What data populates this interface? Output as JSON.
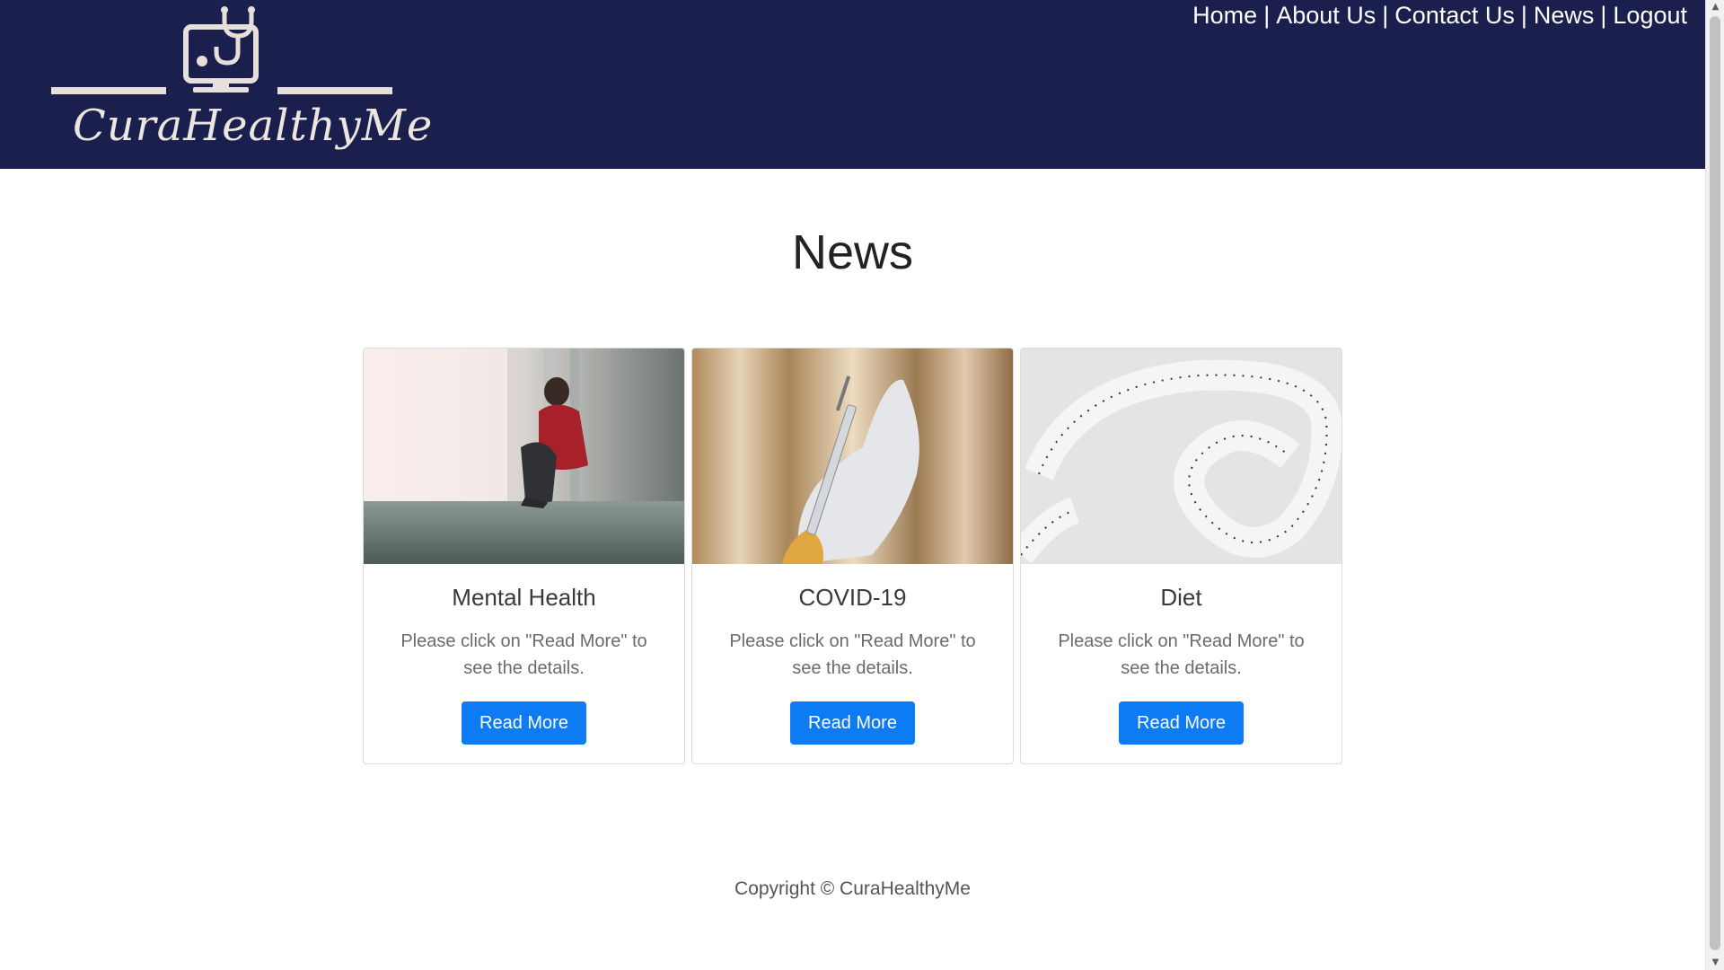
{
  "header": {
    "logo_text": "CuraHealthyMe",
    "nav": [
      "Home",
      "About Us",
      "Contact Us",
      "News",
      "Logout"
    ],
    "nav_separator": "|",
    "background": "#1b1f4d"
  },
  "main": {
    "title": "News",
    "cards": [
      {
        "title": "Mental Health",
        "text": "Please click on \"Read More\" to see the details.",
        "button": "Read More"
      },
      {
        "title": "COVID-19",
        "text": "Please click on \"Read More\" to see the details.",
        "button": "Read More"
      },
      {
        "title": "Diet",
        "text": "Please click on \"Read More\" to see the details.",
        "button": "Read More"
      }
    ]
  },
  "footer": {
    "copyright": "Copyright © CuraHealthyMe"
  },
  "colors": {
    "accent": "#0d7bf3",
    "header_bg": "#1b1f4d"
  },
  "icons": {
    "scroll_up": "scroll-up-arrow",
    "scroll_down": "scroll-down-arrow"
  }
}
